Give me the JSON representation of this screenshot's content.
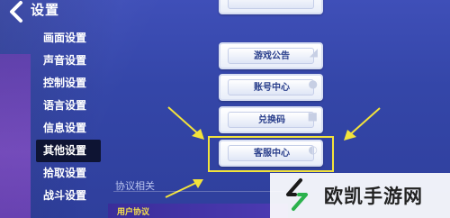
{
  "header": {
    "back_icon": "chevron-left-icon",
    "title": "设置"
  },
  "sidebar": {
    "items": [
      {
        "label": "画面设置",
        "active": false
      },
      {
        "label": "声音设置",
        "active": false
      },
      {
        "label": "控制设置",
        "active": false
      },
      {
        "label": "语言设置",
        "active": false
      },
      {
        "label": "信息设置",
        "active": false
      },
      {
        "label": "其他设置",
        "active": true
      },
      {
        "label": "拾取设置",
        "active": false
      },
      {
        "label": "战斗设置",
        "active": false
      }
    ]
  },
  "main": {
    "buttons": [
      {
        "label": "",
        "icon": "partial-button"
      },
      {
        "label": "游戏公告",
        "icon": "megaphone-icon"
      },
      {
        "label": "账号中心",
        "icon": "user-icon"
      },
      {
        "label": "兑换码",
        "icon": "gift-icon"
      },
      {
        "label": "客服中心",
        "icon": "headset-icon"
      }
    ],
    "section_label": "协议相关",
    "bottom_item": "用户协议"
  },
  "watermark": {
    "text": "欧凯手游网"
  },
  "colors": {
    "background": "#3446a8",
    "highlight_box": "#f3e33b",
    "arrows": "#f3e33b",
    "active_item_bg": "#0e1433",
    "button_text": "#2a3f8c"
  }
}
